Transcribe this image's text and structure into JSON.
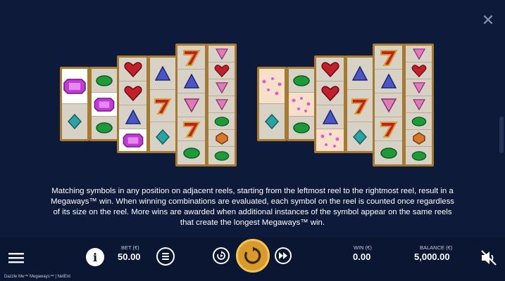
{
  "help": {
    "text": "Matching symbols in any position on adjacent reels, starting from the leftmost reel to the rightmost reel, result in a Megaways™ win. When winning combinations are evaluated, each symbol on the reel is counted once regardless of its size on the reel. More wins are awarded when additional instances of the symbol appear on the same reels that create the longest Megaways™ win."
  },
  "close": {
    "glyph": "✕"
  },
  "bet": {
    "label": "BET (€)",
    "value": "50.00"
  },
  "win": {
    "label": "WIN (€)",
    "value": "0.00"
  },
  "balance": {
    "label": "BALANCE (€)",
    "value": "5,000.00"
  },
  "info": {
    "glyph": "i"
  },
  "footer": {
    "text": "Dazzle Me™ Megaways™ | NetEnt"
  },
  "colors": {
    "background": "#0e1a3a",
    "reel_border": "#a77a34",
    "spin_button": "#d79a2b"
  },
  "icons": [
    "menu-icon",
    "info-icon",
    "coin-stack-icon",
    "autoplay-icon",
    "spin-icon",
    "fast-play-icon",
    "sound-off-icon",
    "close-icon"
  ]
}
